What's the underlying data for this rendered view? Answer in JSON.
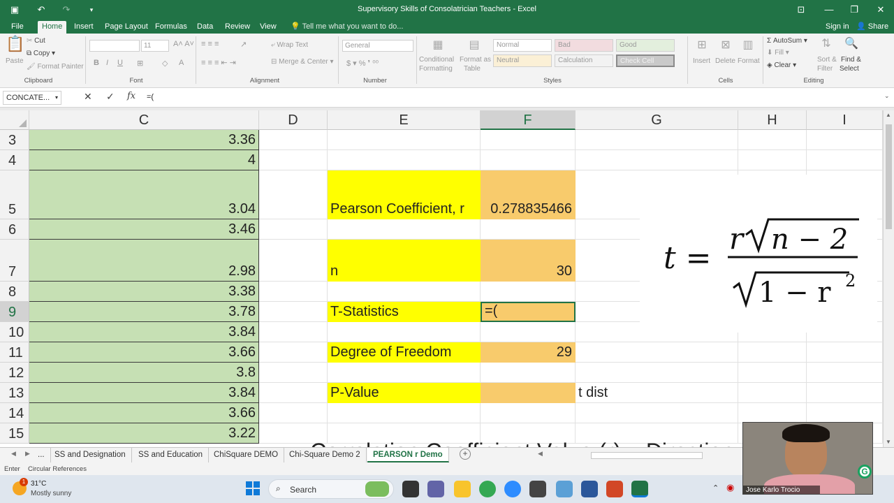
{
  "window": {
    "title": "Supervisory Skills of Consolatrician Teachers - Excel"
  },
  "ribbon_tabs": [
    "File",
    "Home",
    "Insert",
    "Page Layout",
    "Formulas",
    "Data",
    "Review",
    "View"
  ],
  "active_tab": "Home",
  "tell_me": "Tell me what you want to do...",
  "signin": "Sign in",
  "share": "Share",
  "ribbon": {
    "clipboard": {
      "label": "Clipboard",
      "paste": "Paste",
      "cut": "Cut",
      "copy": "Copy",
      "format_painter": "Format Painter"
    },
    "font": {
      "label": "Font",
      "size": "11"
    },
    "alignment": {
      "label": "Alignment",
      "wrap_text": "Wrap Text",
      "merge_center": "Merge & Center"
    },
    "number": {
      "label": "Number",
      "format": "General"
    },
    "styles": {
      "label": "Styles",
      "conditional": "Conditional Formatting",
      "conditional_l1": "Conditional",
      "conditional_l2": "Formatting",
      "format_as_table_l1": "Format as",
      "format_as_table_l2": "Table",
      "cells": [
        "Normal",
        "Bad",
        "Good",
        "Neutral",
        "Calculation",
        "Check Cell"
      ]
    },
    "cells": {
      "label": "Cells",
      "insert": "Insert",
      "delete": "Delete",
      "format": "Format"
    },
    "editing": {
      "label": "Editing",
      "autosum": "AutoSum",
      "fill": "Fill",
      "clear": "Clear",
      "sort_l1": "Sort &",
      "sort_l2": "Filter",
      "find_l1": "Find &",
      "find_l2": "Select"
    }
  },
  "formula_bar": {
    "name_box": "CONCATE...",
    "formula": "=("
  },
  "columns": [
    "C",
    "D",
    "E",
    "F",
    "G",
    "H",
    "I"
  ],
  "selected_column": "F",
  "rows": [
    {
      "n": "3",
      "c": "3.36",
      "e": "",
      "f": "",
      "g": ""
    },
    {
      "n": "4",
      "c": "4",
      "e": "",
      "f": "",
      "g": ""
    },
    {
      "n": "5",
      "c": "3.04",
      "e": "Pearson Coefficient, r",
      "f": "0.278835466",
      "g": ""
    },
    {
      "n": "6",
      "c": "3.46",
      "e": "",
      "f": "",
      "g": ""
    },
    {
      "n": "7",
      "c": "2.98",
      "e": "n",
      "f": "30",
      "g": ""
    },
    {
      "n": "8",
      "c": "3.38",
      "e": "",
      "f": "",
      "g": ""
    },
    {
      "n": "9",
      "c": "3.78",
      "e": "T-Statistics",
      "f": "=(",
      "g": ""
    },
    {
      "n": "10",
      "c": "3.84",
      "e": "",
      "f": "",
      "g": ""
    },
    {
      "n": "11",
      "c": "3.66",
      "e": "Degree of Freedom",
      "f": "29",
      "g": ""
    },
    {
      "n": "12",
      "c": "3.8",
      "e": "",
      "f": "",
      "g": ""
    },
    {
      "n": "13",
      "c": "3.84",
      "e": "P-Value",
      "f": "",
      "g": "t dist"
    },
    {
      "n": "14",
      "c": "3.66",
      "e": "",
      "f": "",
      "g": ""
    },
    {
      "n": "15",
      "c": "3.22",
      "e": "",
      "f": "",
      "g": ""
    }
  ],
  "formula_image": {
    "lhs": "t =",
    "numerator_r": "r",
    "numerator_rad": "n − 2",
    "denominator_rad": "1 − r",
    "exponent": "2"
  },
  "overflow_heading": "Correlation Coefficient Value (r) – Direction",
  "sheet_tabs": [
    "...",
    "SS and Designation",
    "SS and Education",
    "ChiSquare DEMO",
    "Chi-Square Demo 2",
    "PEARSON r Demo"
  ],
  "active_sheet": "PEARSON r Demo",
  "status": {
    "mode": "Enter",
    "circular": "Circular References"
  },
  "taskbar": {
    "weather_temp": "31°C",
    "weather_desc": "Mostly sunny",
    "weather_badge": "1",
    "search": "Search"
  },
  "webcam": {
    "name": "Jose Karlo Trocio"
  },
  "colors": {
    "excel_green": "#217346",
    "cell_green": "#c6e0b4",
    "cell_yellow": "#ffff00",
    "cell_orange": "#f8cb6c"
  }
}
